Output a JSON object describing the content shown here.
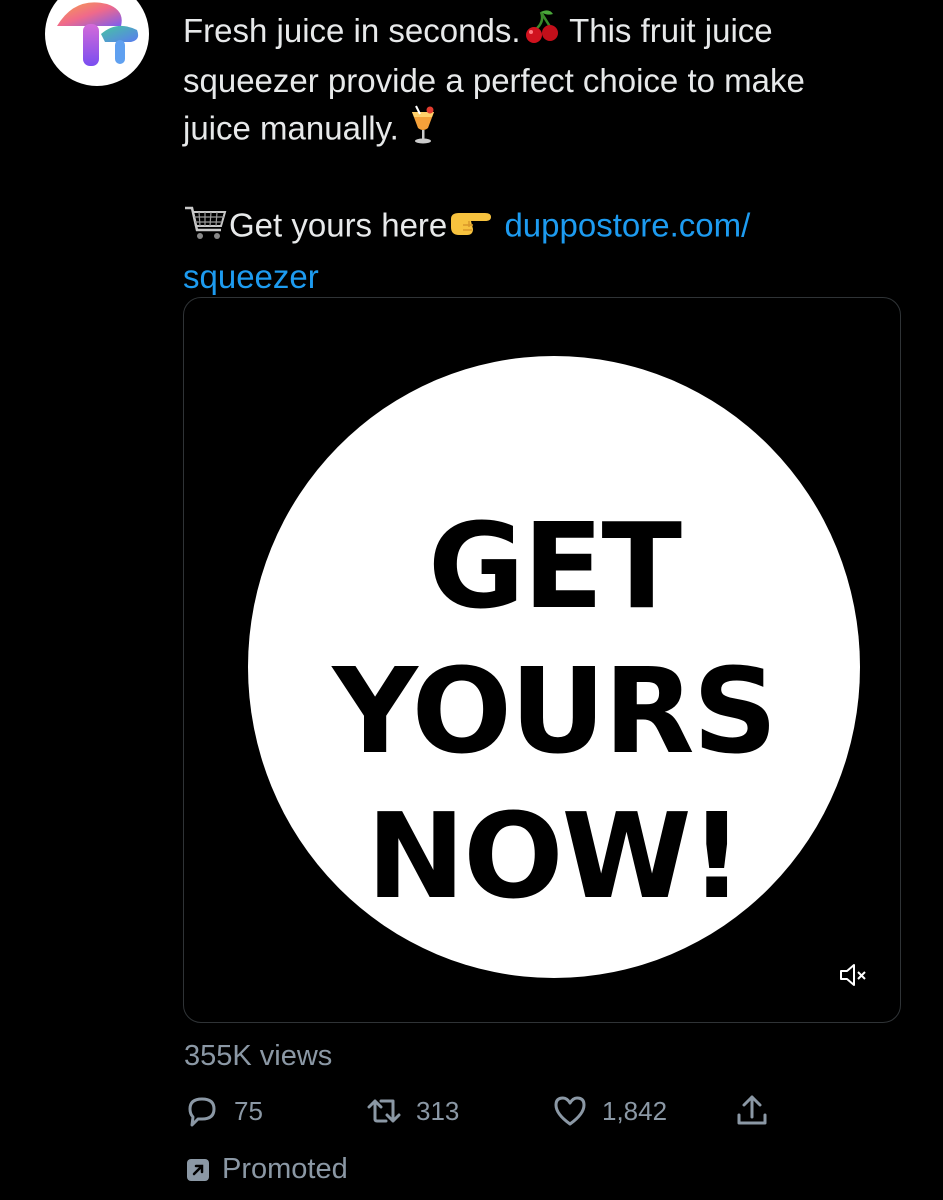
{
  "tweet": {
    "line1": "Fresh juice in seconds.",
    "line1_after": " This fruit juice",
    "line2": "squeezer provide a perfect choice to make",
    "line3": "juice manually.",
    "cta_text": "Get yours here",
    "link_part1": "duppostore.com/",
    "link_part2": "squeezer"
  },
  "media": {
    "line1": "GET",
    "line2": "YOURS",
    "line3": "NOW!"
  },
  "stats": {
    "views": "355K views",
    "replies": "75",
    "retweets": "313",
    "likes": "1,842"
  },
  "promoted_label": "Promoted",
  "colors": {
    "background": "#000000",
    "text": "#e7e9ea",
    "secondary": "#8b98a5",
    "link": "#1d9bf0"
  },
  "icons": [
    "avatar-mushroom-icon",
    "cherry-icon",
    "cocktail-icon",
    "cart-icon",
    "pointing-hand-icon",
    "mute-icon",
    "reply-icon",
    "retweet-icon",
    "like-icon",
    "share-icon",
    "promoted-icon"
  ]
}
